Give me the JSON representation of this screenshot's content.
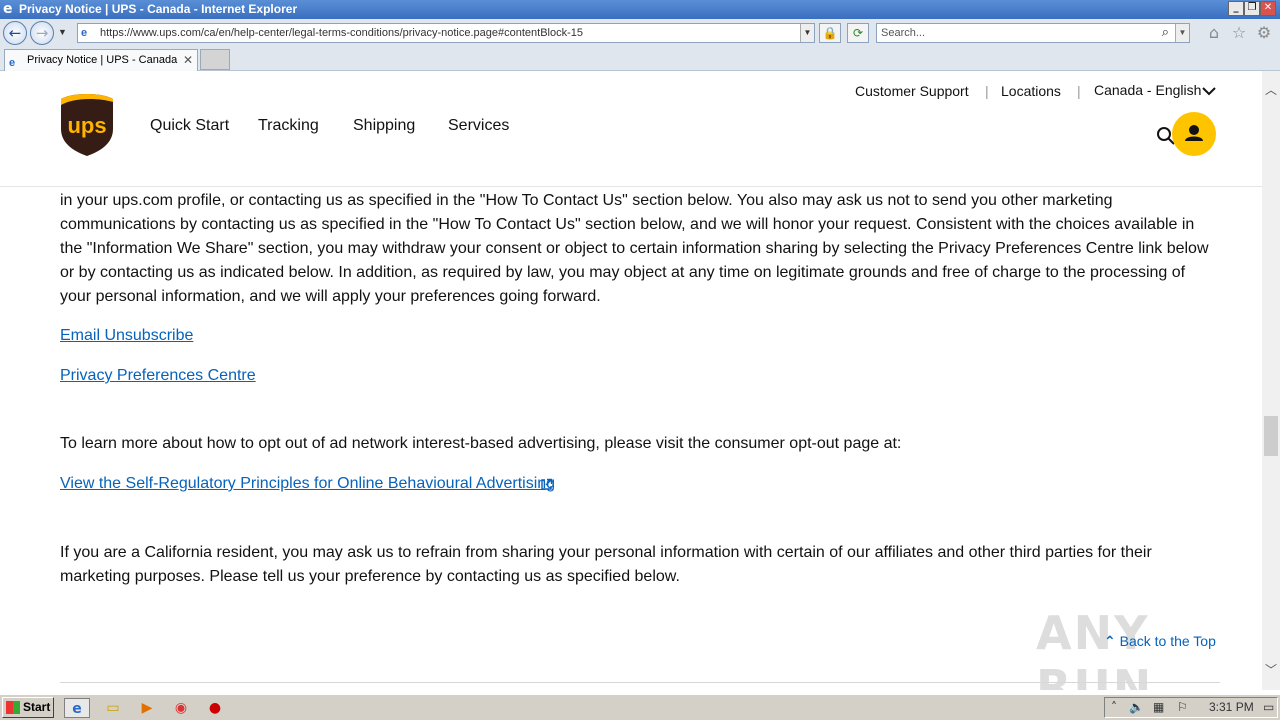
{
  "window": {
    "title": "Privacy Notice | UPS - Canada - Internet Explorer",
    "minimize": "_",
    "restore": "❐",
    "close": "✕"
  },
  "address_bar": {
    "url": "https://www.ups.com/ca/en/help-center/legal-terms-conditions/privacy-notice.page#contentBlock-15",
    "search_placeholder": "Search..."
  },
  "tab": {
    "label": "Privacy Notice | UPS - Canada",
    "close": "✕"
  },
  "site": {
    "logo_text": "ups",
    "nav": [
      "Quick Start",
      "Tracking",
      "Shipping",
      "Services"
    ],
    "util": {
      "support": "Customer Support",
      "locations": "Locations",
      "locale": "Canada - English",
      "separator": "|"
    },
    "colors": {
      "brand_brown": "#351c15",
      "brand_gold": "#ffb500",
      "link": "#0662bb",
      "avatar": "#ffc400"
    }
  },
  "content": {
    "para1": "in your ups.com profile, or contacting us as specified in the \"How To Contact Us\" section below. You also may ask us not to send you other marketing communications by contacting us as specified in the \"How To Contact Us\" section below, and we will honor your request. Consistent with the choices available in the \"Information We Share\" section, you may withdraw your consent or object to certain information sharing by selecting the Privacy Preferences Centre link below or by contacting us as indicated below. In addition, as required by law, you may object at any time on legitimate grounds and free of charge to the processing of your personal information, and we will apply your preferences going forward.",
    "link_unsubscribe": "Email Unsubscribe",
    "link_privacy_centre": "Privacy Preferences Centre",
    "para2": "To learn more about how to opt out of ad network interest-based advertising, please visit the consumer opt-out page at:",
    "link_self_regulatory": "View the Self-Regulatory Principles for Online Behavioural Advertising",
    "para3": "If you are a California resident, you may ask us to refrain from sharing your personal information with certain of our affiliates and other third parties for their marketing purposes. Please tell us your preference by contacting us as specified below.",
    "back_to_top": "Back to the Top",
    "watermark": "ANY RUN"
  },
  "taskbar": {
    "start": "Start",
    "clock": "3:31 PM"
  }
}
